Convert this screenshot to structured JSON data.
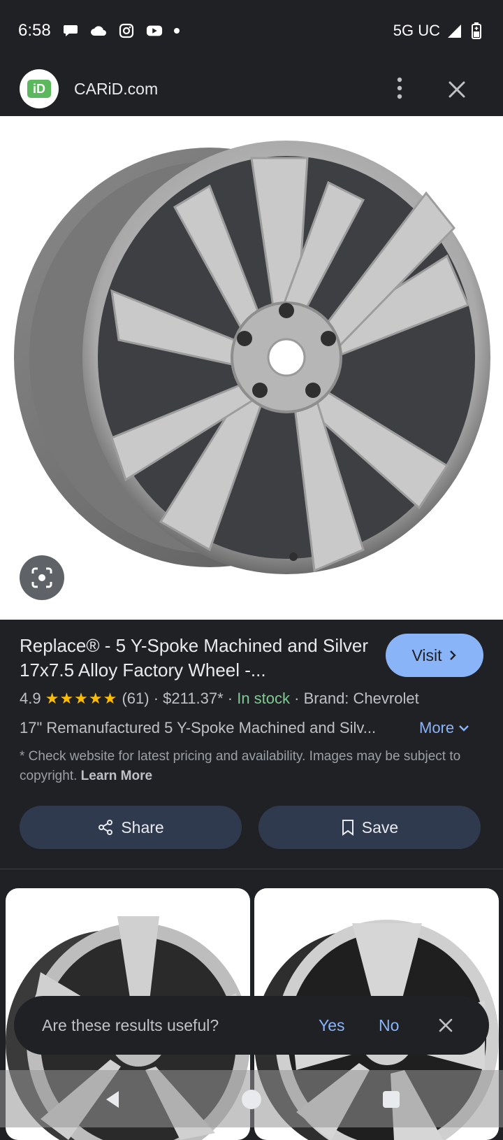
{
  "status": {
    "time": "6:58",
    "network": "5G UC",
    "icons": [
      "chat-bubble-icon",
      "cloud-icon",
      "instagram-icon",
      "youtube-icon",
      "notification-dot-icon",
      "signal-icon",
      "battery-charging-icon"
    ]
  },
  "header": {
    "logo_text": "iD",
    "site": "CARiD.com",
    "icons": [
      "more-vertical-icon",
      "close-icon"
    ]
  },
  "result": {
    "title": "Replace® - 5 Y-Spoke Machined and Silver 17x7.5 Alloy Factory Wheel -...",
    "visit_label": "Visit",
    "rating": "4.9",
    "stars": "★★★★★",
    "reviews": "(61)",
    "sep1": "·",
    "price": "$211.37*",
    "sep2": "·",
    "stock": "In stock",
    "sep3": "·",
    "brand": "Brand: Chevrolet",
    "description": "17\" Remanufactured 5 Y-Spoke Machined and Silv...",
    "more_label": "More",
    "disclaimer": "* Check website for latest pricing and availability. Images may be subject to copyright.",
    "learn_more": "Learn More",
    "share_label": "Share",
    "save_label": "Save"
  },
  "feedback": {
    "question": "Are these results useful?",
    "yes": "Yes",
    "no": "No"
  },
  "colors": {
    "background": "#202124",
    "accent": "#8ab4f8",
    "in_stock": "#81c995",
    "star": "#fbbc04",
    "button": "#303a4f"
  }
}
